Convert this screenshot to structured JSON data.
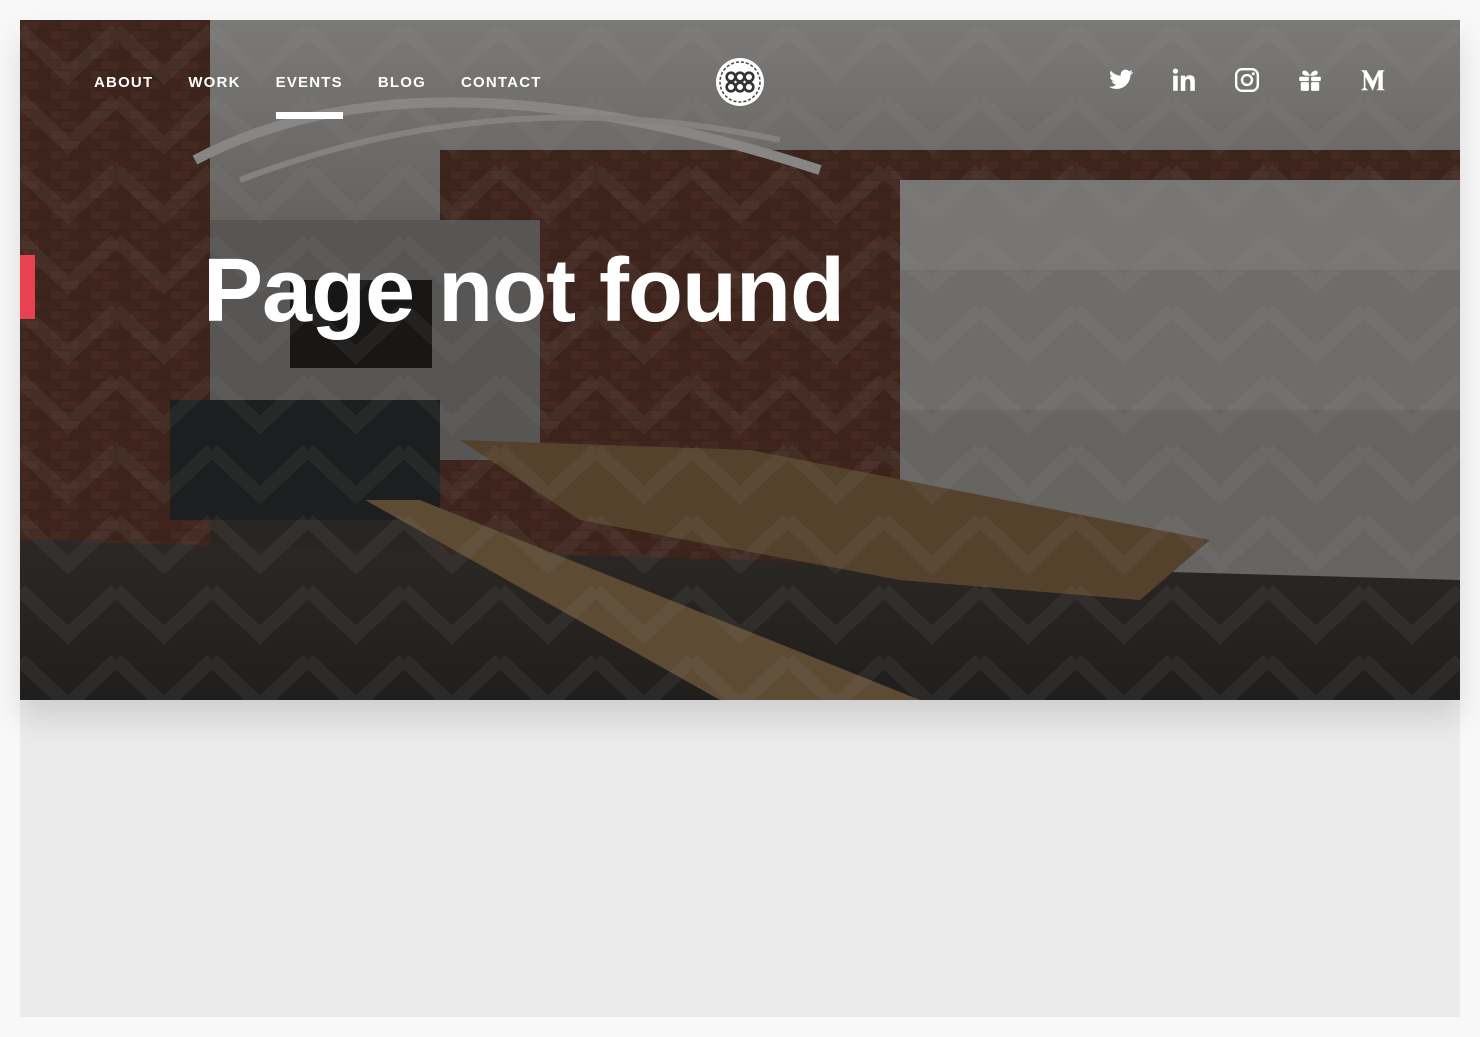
{
  "nav": {
    "items": [
      {
        "label": "ABOUT",
        "active": false
      },
      {
        "label": "WORK",
        "active": false
      },
      {
        "label": "EVENTS",
        "active": true
      },
      {
        "label": "BLOG",
        "active": false
      },
      {
        "label": "CONTACT",
        "active": false
      }
    ]
  },
  "logo": {
    "icon": "badge-logo-icon"
  },
  "social": {
    "icons": [
      "twitter-icon",
      "linkedin-icon",
      "instagram-icon",
      "gift-icon",
      "medium-icon"
    ]
  },
  "hero": {
    "title": "Page not found",
    "accent_color": "#e8414f"
  }
}
